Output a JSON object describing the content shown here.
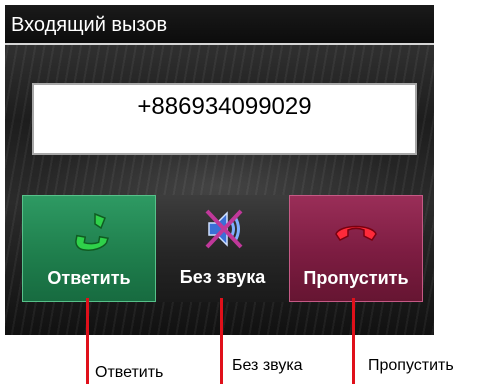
{
  "dialog": {
    "title": "Входящий вызов",
    "phone_number": "+886934099029"
  },
  "buttons": {
    "answer": {
      "label": "Ответить",
      "icon": "phone-answer-icon",
      "color": "#1f7f4d"
    },
    "silent": {
      "label": "Без звука",
      "icon": "speaker-muted-icon",
      "color": "#262626"
    },
    "reject": {
      "label": "Пропустить",
      "icon": "phone-hangup-icon",
      "color": "#7c1c41"
    }
  },
  "callouts": {
    "answer": "Ответить",
    "silent": "Без звука",
    "reject": "Пропустить"
  },
  "colors": {
    "callout_line": "#e0101a"
  }
}
